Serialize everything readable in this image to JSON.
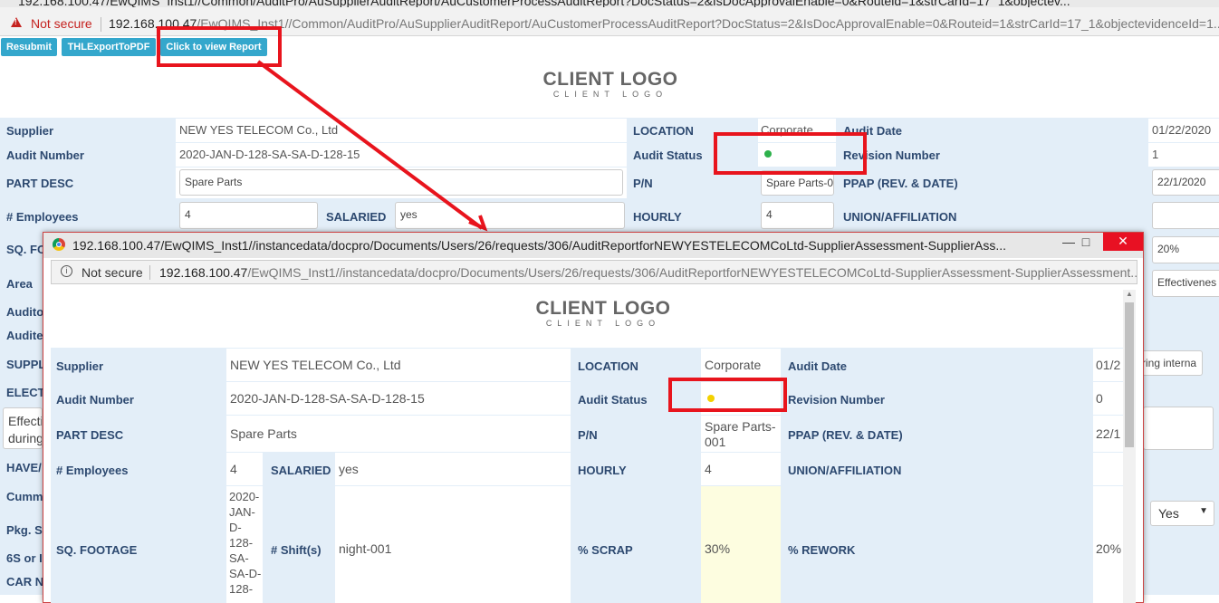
{
  "browser": {
    "title": "192.168.100.47/EwQIMS_Inst1//Common/AuditPro/AuSupplierAuditReport/AuCustomerProcessAuditReport?DocStatus=2&IsDocApprovalEnable=0&Routeid=1&strCarId=17_1&objectev...",
    "not_secure": "Not secure",
    "url_host": "192.168.100.47",
    "url_path": "/EwQIMS_Inst1//Common/AuditPro/AuSupplierAuditReport/AuCustomerProcessAuditReport?DocStatus=2&IsDocApprovalEnable=0&Routeid=1&strCarId=17_1&objectevidenceId=1..."
  },
  "toolbar": {
    "resubmit": "Resubmit",
    "export_pdf": "THLExportToPDF",
    "view_report": "Click to view Report"
  },
  "logo": {
    "line1": "CLIENT LOGO",
    "line2": "CLIENT LOGO"
  },
  "form": {
    "supplier_label": "Supplier",
    "supplier": "NEW YES TELECOM Co., Ltd",
    "location_label": "LOCATION",
    "location": "Corporate",
    "audit_date_label": "Audit Date",
    "audit_date": "01/22/2020",
    "audit_number_label": "Audit Number",
    "audit_number": "2020-JAN-D-128-SA-SA-D-128-15",
    "audit_status_label": "Audit Status",
    "revision_label": "Revision Number",
    "revision": "1",
    "part_desc_label": "PART DESC",
    "part_desc": "Spare Parts",
    "pn_label": "P/N",
    "pn": "Spare Parts-0",
    "ppap_label": "PPAP (REV. & DATE)",
    "ppap": "22/1/2020",
    "employees_label": "# Employees",
    "employees": "4",
    "salaried_label": "SALARIED",
    "salaried": "yes",
    "hourly_label": "HOURLY",
    "hourly": "4",
    "union_label": "UNION/AFFILIATION",
    "sq_label": "SQ. FO",
    "rework_value": "20%",
    "area_label": "Area",
    "area_value": "Effectivenes",
    "auditor_label": "Audito",
    "auditee_label": "Audite",
    "supplier2_label": "SUPPL",
    "internal_value": "ring interna",
    "elect_label": "ELECT",
    "effect_text1": "Effecti",
    "effect_text2": "during",
    "have_label": "HAVE/",
    "cumm_label": "Cummi",
    "pkg_label": "Pkg. St",
    "six_s_label": "6S or I",
    "car_label": "CAR Ne",
    "yes_select": "Yes"
  },
  "popup": {
    "title": "192.168.100.47/EwQIMS_Inst1//instancedata/docpro/Documents/Users/26/requests/306/AuditReportforNEWYESTELECOMCoLtd-SupplierAssessment-SupplierAss...",
    "not_secure": "Not secure",
    "url_host": "192.168.100.47",
    "url_path": "/EwQIMS_Inst1//instancedata/docpro/Documents/Users/26/requests/306/AuditReportforNEWYESTELECOMCoLtd-SupplierAssessment-SupplierAssessment...",
    "supplier_label": "Supplier",
    "supplier": "NEW YES TELECOM Co., Ltd",
    "location_label": "LOCATION",
    "location": "Corporate",
    "audit_date_label": "Audit Date",
    "audit_date": "01/2",
    "audit_number_label": "Audit Number",
    "audit_number": "2020-JAN-D-128-SA-SA-D-128-15",
    "audit_status_label": "Audit Status",
    "revision_label": "Revision Number",
    "revision": "0",
    "part_desc_label": "PART DESC",
    "part_desc": "Spare Parts",
    "pn_label": "P/N",
    "pn_line1": "Spare Parts-",
    "pn_line2": "001",
    "ppap_label": "PPAP (REV. & DATE)",
    "ppap": "22/1",
    "employees_label": "# Employees",
    "employees": "4",
    "salaried_label": "SALARIED",
    "salaried": "yes",
    "hourly_label": "HOURLY",
    "hourly": "4",
    "union_label": "UNION/AFFILIATION",
    "sq_label": "SQ. FOOTAGE",
    "sq_lines": [
      "2020-",
      "JAN-",
      "D-",
      "128-",
      "SA-",
      "SA-D-",
      "128-"
    ],
    "shift_label": "# Shift(s)",
    "shift": "night-001",
    "scrap_label": "% SCRAP",
    "scrap": "30%",
    "rework_label": "% REWORK",
    "rework": "20%"
  },
  "colors": {
    "status_green": "#2db14b",
    "status_yellow": "#f3d100",
    "annotation": "#e8141d"
  }
}
